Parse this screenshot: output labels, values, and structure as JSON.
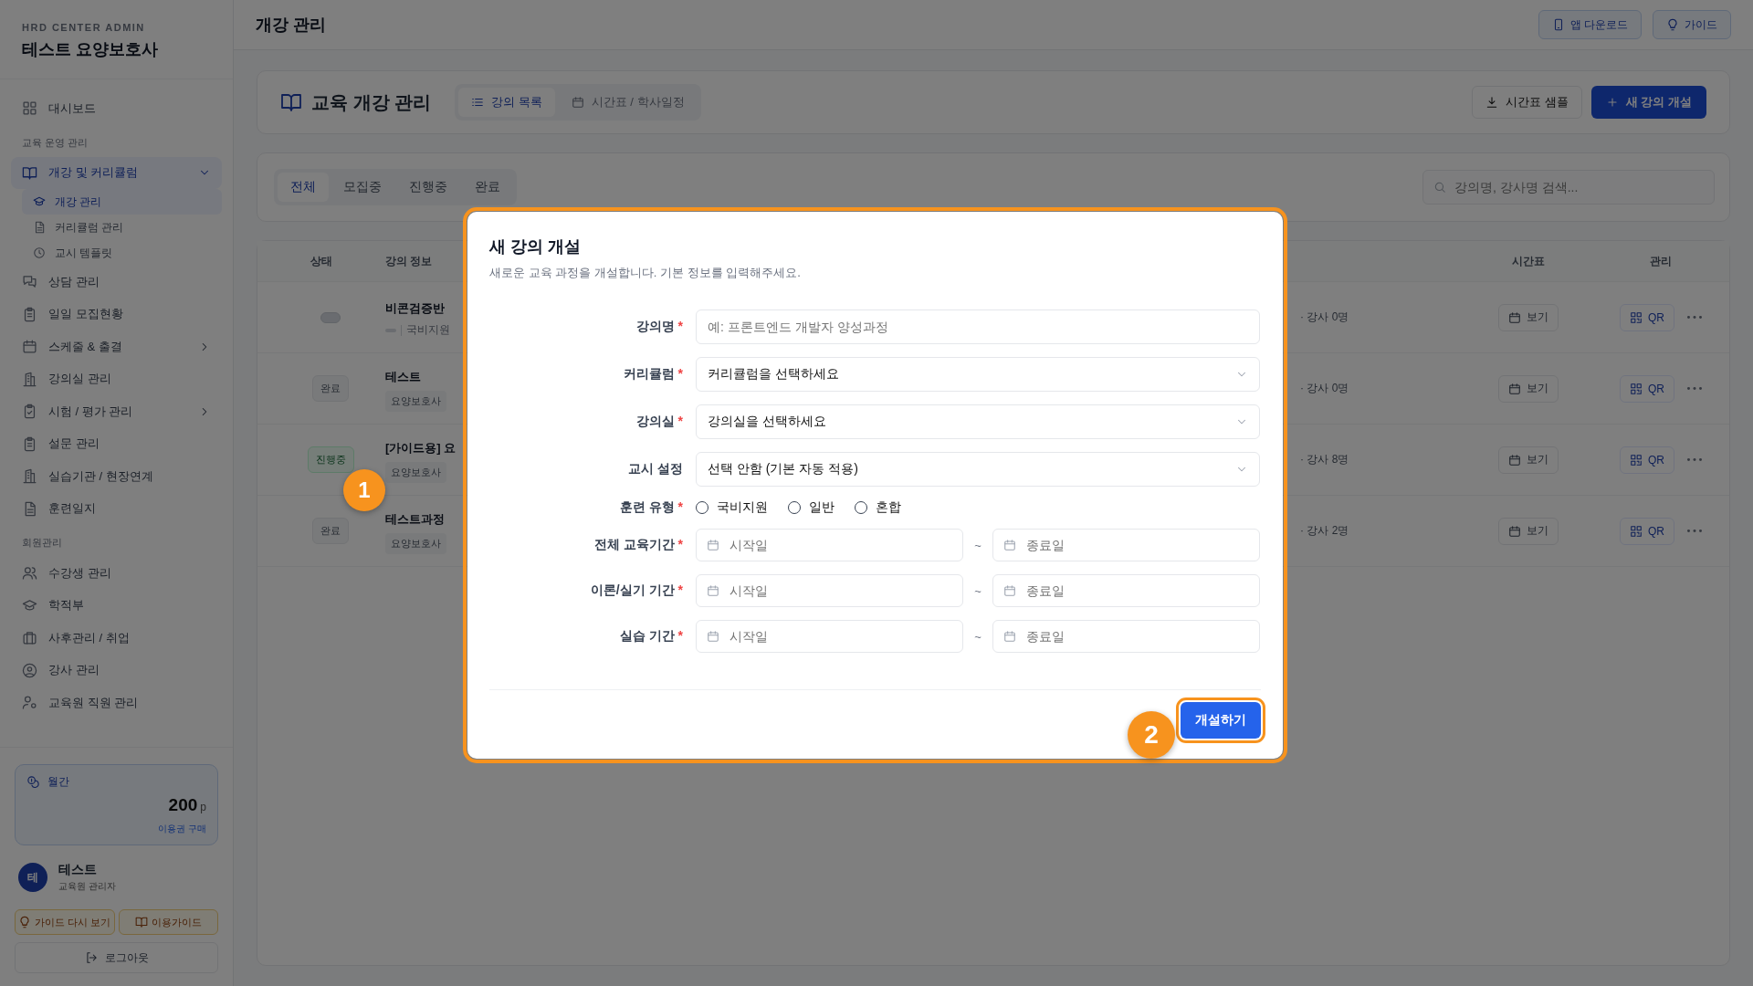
{
  "sidebar": {
    "subtitle": "HRD CENTER ADMIN",
    "title": "테스트 요양보호사",
    "sections": [
      {
        "items": [
          {
            "label": "대시보드",
            "selected": false
          }
        ]
      },
      {
        "heading": "교육 운영 관리",
        "items": [
          {
            "label": "개강 및 커리큘럼",
            "selected": false,
            "expanded": true,
            "children": [
              {
                "label": "개강 관리",
                "selected": true
              },
              {
                "label": "커리큘럼 관리",
                "selected": false
              },
              {
                "label": "교시 템플릿",
                "selected": false
              }
            ]
          },
          {
            "label": "상담 관리",
            "selected": false
          },
          {
            "label": "일일 모집현황",
            "selected": false
          },
          {
            "label": "스케줄 & 출결",
            "selected": false,
            "expanded": false
          },
          {
            "label": "강의실 관리",
            "selected": false
          },
          {
            "label": "시험 / 평가 관리",
            "selected": false,
            "expanded": false
          },
          {
            "label": "설문 관리",
            "selected": false
          },
          {
            "label": "실습기관 / 현장연계",
            "selected": false
          },
          {
            "label": "훈련일지",
            "selected": false
          }
        ]
      },
      {
        "heading": "회원관리",
        "items": [
          {
            "label": "수강생 관리",
            "selected": false
          },
          {
            "label": "학적부",
            "selected": false
          },
          {
            "label": "사후관리 / 취업",
            "selected": false
          },
          {
            "label": "강사 관리",
            "selected": false
          },
          {
            "label": "교육원 직원 관리",
            "selected": false
          }
        ]
      }
    ],
    "plan": {
      "label": "월간",
      "amount": "200",
      "unit": "p",
      "link": "이용권 구매"
    },
    "user": {
      "initial": "테",
      "name": "테스트",
      "role": "교육원 관리자"
    },
    "buttons": [
      "가이드 다시 보기",
      "이용가이드"
    ],
    "logout": "로그아웃"
  },
  "topbar": {
    "title": "개강 관리",
    "buttons": [
      "앱 다운로드",
      "가이드"
    ]
  },
  "header": {
    "title": "교육 개강 관리",
    "view_tabs": [
      {
        "label": "강의 목록",
        "selected": true
      },
      {
        "label": "시간표 / 학사일정",
        "selected": false
      }
    ],
    "sample_button": "시간표 샘플",
    "new_button": "새 강의 개설"
  },
  "filters": {
    "tabs": [
      {
        "label": "전체",
        "selected": true
      },
      {
        "label": "모집중",
        "selected": false
      },
      {
        "label": "진행중",
        "selected": false
      },
      {
        "label": "완료",
        "selected": false
      }
    ],
    "search": {
      "placeholder": "강의명, 강사명 검색..."
    }
  },
  "table": {
    "columns": [
      "상태",
      "강의 정보",
      "시간표",
      "관리"
    ],
    "rows": [
      {
        "status": {
          "kind": "blank"
        },
        "title": "비콘검증반",
        "tags": [
          {
            "kind": "blank"
          },
          {
            "kind": "plain",
            "label": "국비지원"
          }
        ],
        "stats": "· 강사 0명",
        "schedule": "보기",
        "qr": "QR"
      },
      {
        "status": {
          "kind": "done",
          "label": "완료"
        },
        "title": "테스트",
        "tags": [
          {
            "kind": "pill",
            "label": "요양보호사"
          }
        ],
        "stats": "· 강사 0명",
        "schedule": "보기",
        "qr": "QR"
      },
      {
        "status": {
          "kind": "active",
          "label": "진행중"
        },
        "title": "[가이드용] 요",
        "tags": [
          {
            "kind": "pill",
            "label": "요양보호사"
          }
        ],
        "stats": "· 강사 8명",
        "schedule": "보기",
        "qr": "QR"
      },
      {
        "status": {
          "kind": "done",
          "label": "완료"
        },
        "title": "테스트과정",
        "tags": [
          {
            "kind": "pill",
            "label": "요양보호사"
          }
        ],
        "stats": "· 강사 2명",
        "schedule": "보기",
        "qr": "QR"
      }
    ]
  },
  "modal": {
    "title": "새 강의 개설",
    "description": "새로운 교육 과정을 개설합니다. 기본 정보를 입력해주세요.",
    "fields": [
      {
        "kind": "text",
        "label": "강의명",
        "required_mark": "*",
        "placeholder": "예: 프론트엔드 개발자 양성과정"
      },
      {
        "kind": "select",
        "label": "커리큘럼",
        "required_mark": "*",
        "value": "커리큘럼을 선택하세요"
      },
      {
        "kind": "select",
        "label": "강의실",
        "required_mark": "*",
        "value": "강의실을 선택하세요"
      },
      {
        "kind": "select",
        "label": "교시 설정",
        "value": "선택 안함 (기본 자동 적용)"
      },
      {
        "kind": "radio",
        "label": "훈련 유형",
        "required_mark": "*",
        "options": [
          {
            "label": "국비지원",
            "selected": false
          },
          {
            "label": "일반",
            "selected": false
          },
          {
            "label": "혼합",
            "selected": false
          }
        ]
      },
      {
        "kind": "range",
        "label": "전체 교육기간",
        "required_mark": "*",
        "start_placeholder": "시작일",
        "separator": "~",
        "end_placeholder": "종료일"
      },
      {
        "kind": "range",
        "label": "이론/실기 기간",
        "required_mark": "*",
        "start_placeholder": "시작일",
        "separator": "~",
        "end_placeholder": "종료일"
      },
      {
        "kind": "range",
        "label": "실습 기간",
        "required_mark": "*",
        "start_placeholder": "시작일",
        "separator": "~",
        "end_placeholder": "종료일"
      }
    ],
    "submit": {
      "label": "개설하기",
      "highlighted": true
    }
  },
  "steps": [
    "1",
    "2"
  ]
}
